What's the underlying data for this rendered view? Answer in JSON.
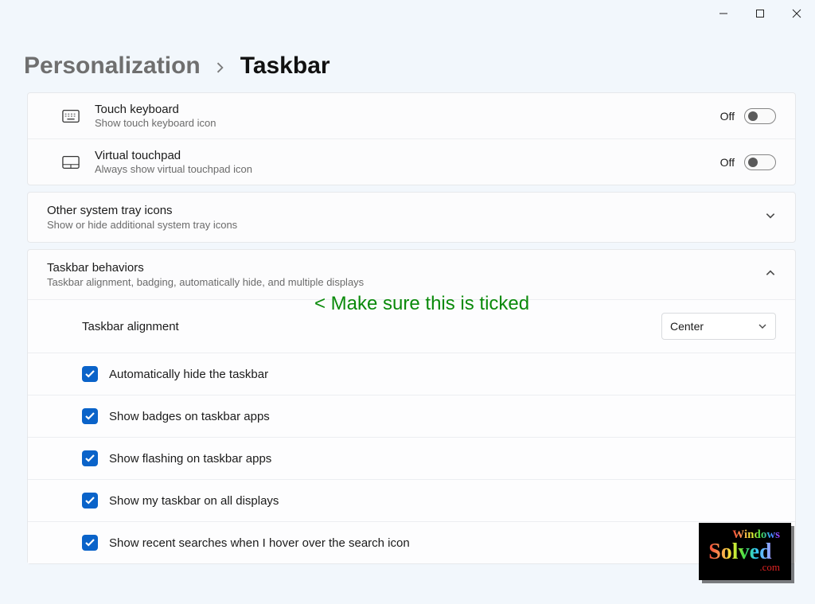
{
  "window_controls": {
    "minimize": "minimize",
    "maximize": "maximize",
    "close": "close"
  },
  "breadcrumb": {
    "parent": "Personalization",
    "current": "Taskbar"
  },
  "corner_icons": [
    {
      "icon": "touch-keyboard",
      "title": "Touch keyboard",
      "subtitle": "Show touch keyboard icon",
      "state_label": "Off",
      "on": false
    },
    {
      "icon": "virtual-touchpad",
      "title": "Virtual touchpad",
      "subtitle": "Always show virtual touchpad icon",
      "state_label": "Off",
      "on": false
    }
  ],
  "other_tray": {
    "title": "Other system tray icons",
    "subtitle": "Show or hide additional system tray icons",
    "expanded": false
  },
  "behaviors": {
    "title": "Taskbar behaviors",
    "subtitle": "Taskbar alignment, badging, automatically hide, and multiple displays",
    "expanded": true,
    "alignment": {
      "label": "Taskbar alignment",
      "value": "Center"
    },
    "checks": [
      {
        "label": "Automatically hide the taskbar",
        "checked": true
      },
      {
        "label": "Show badges on taskbar apps",
        "checked": true
      },
      {
        "label": "Show flashing on taskbar apps",
        "checked": true
      },
      {
        "label": "Show my taskbar on all displays",
        "checked": true
      },
      {
        "label": "Show recent searches when I hover over the search icon",
        "checked": true
      }
    ]
  },
  "annotation": "< Make sure this is ticked",
  "watermark": {
    "line1": "Windows",
    "line2": "Solved",
    "line3": ".com"
  }
}
